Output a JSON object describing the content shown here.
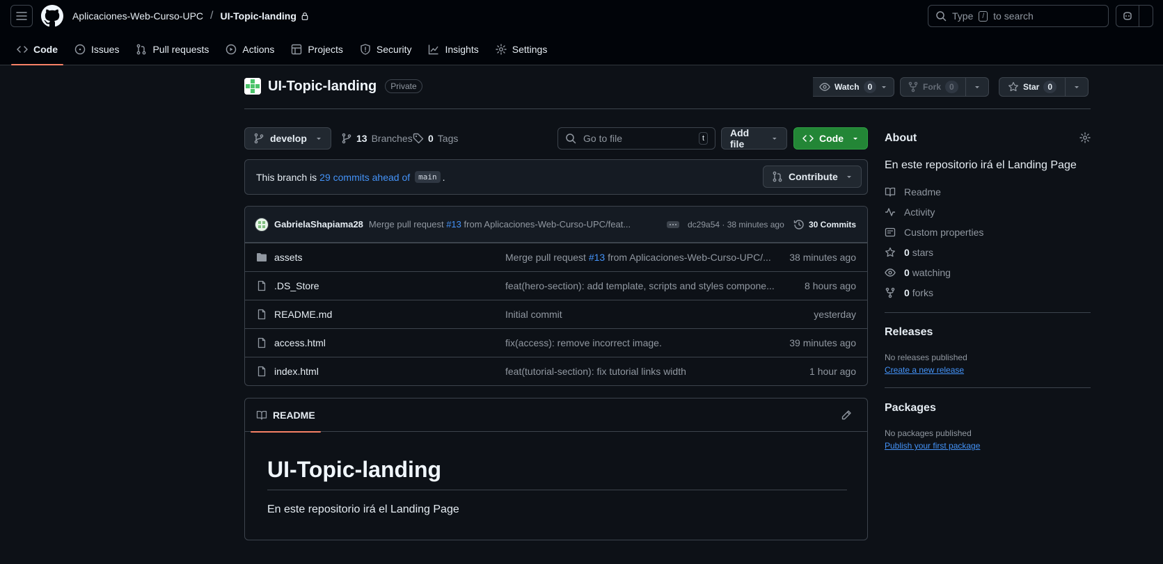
{
  "header": {
    "owner": "Aplicaciones-Web-Curso-UPC",
    "separator": "/",
    "repo": "UI-Topic-landing",
    "search_prefix": "Type",
    "search_key": "/",
    "search_suffix": "to search"
  },
  "tabs": [
    {
      "label": "Code"
    },
    {
      "label": "Issues"
    },
    {
      "label": "Pull requests"
    },
    {
      "label": "Actions"
    },
    {
      "label": "Projects"
    },
    {
      "label": "Security"
    },
    {
      "label": "Insights"
    },
    {
      "label": "Settings"
    }
  ],
  "repo": {
    "name": "UI-Topic-landing",
    "visibility": "Private",
    "watch_label": "Watch",
    "watch_count": "0",
    "fork_label": "Fork",
    "fork_count": "0",
    "star_label": "Star",
    "star_count": "0"
  },
  "toolbar": {
    "branch": "develop",
    "branches_count": "13",
    "branches_label": "Branches",
    "tags_count": "0",
    "tags_label": "Tags",
    "goto_placeholder": "Go to file",
    "goto_key": "t",
    "add_file": "Add file",
    "code": "Code"
  },
  "branch_status": {
    "prefix": "This branch is",
    "link": "29 commits ahead of",
    "base": "main",
    "suffix": ".",
    "contribute": "Contribute"
  },
  "latest_commit": {
    "author": "GabrielaShapiama28",
    "msg_prefix": "Merge pull request",
    "pr": "#13",
    "msg_suffix": "from Aplicaciones-Web-Curso-UPC/feat...",
    "meta": "dc29a54 · 38 minutes ago",
    "commits_count": "30 Commits"
  },
  "files": [
    {
      "name": "assets",
      "type": "folder",
      "msg_prefix": "Merge pull request",
      "pr": "#13",
      "msg_suffix": "from Aplicaciones-Web-Curso-UPC/...",
      "age": "38 minutes ago"
    },
    {
      "name": ".DS_Store",
      "type": "file",
      "msg_prefix": "feat(hero-section): add template, scripts and styles compone...",
      "pr": "",
      "msg_suffix": "",
      "age": "8 hours ago"
    },
    {
      "name": "README.md",
      "type": "file",
      "msg_prefix": "Initial commit",
      "pr": "",
      "msg_suffix": "",
      "age": "yesterday"
    },
    {
      "name": "access.html",
      "type": "file",
      "msg_prefix": "fix(access): remove incorrect image.",
      "pr": "",
      "msg_suffix": "",
      "age": "39 minutes ago"
    },
    {
      "name": "index.html",
      "type": "file",
      "msg_prefix": "feat(tutorial-section): fix tutorial links width",
      "pr": "",
      "msg_suffix": "",
      "age": "1 hour ago"
    }
  ],
  "readme": {
    "tab": "README",
    "heading": "UI-Topic-landing",
    "body": "En este repositorio irá el Landing Page"
  },
  "about": {
    "title": "About",
    "description": "En este repositorio irá el Landing Page",
    "items": [
      {
        "label": "Readme",
        "icon": "book-icon"
      },
      {
        "label": "Activity",
        "icon": "pulse-icon"
      },
      {
        "label": "Custom properties",
        "icon": "note-icon"
      },
      {
        "count": "0",
        "label": "stars",
        "icon": "star-icon"
      },
      {
        "count": "0",
        "label": "watching",
        "icon": "eye-icon"
      },
      {
        "count": "0",
        "label": "forks",
        "icon": "fork-icon"
      }
    ]
  },
  "releases": {
    "title": "Releases",
    "empty": "No releases published",
    "link": "Create a new release"
  },
  "packages": {
    "title": "Packages",
    "empty": "No packages published",
    "link": "Publish your first package"
  },
  "colors": {
    "background": "#0d1117",
    "header": "#010409",
    "accent_tab": "#f78166",
    "link": "#4493f8",
    "code_button": "#238636"
  }
}
